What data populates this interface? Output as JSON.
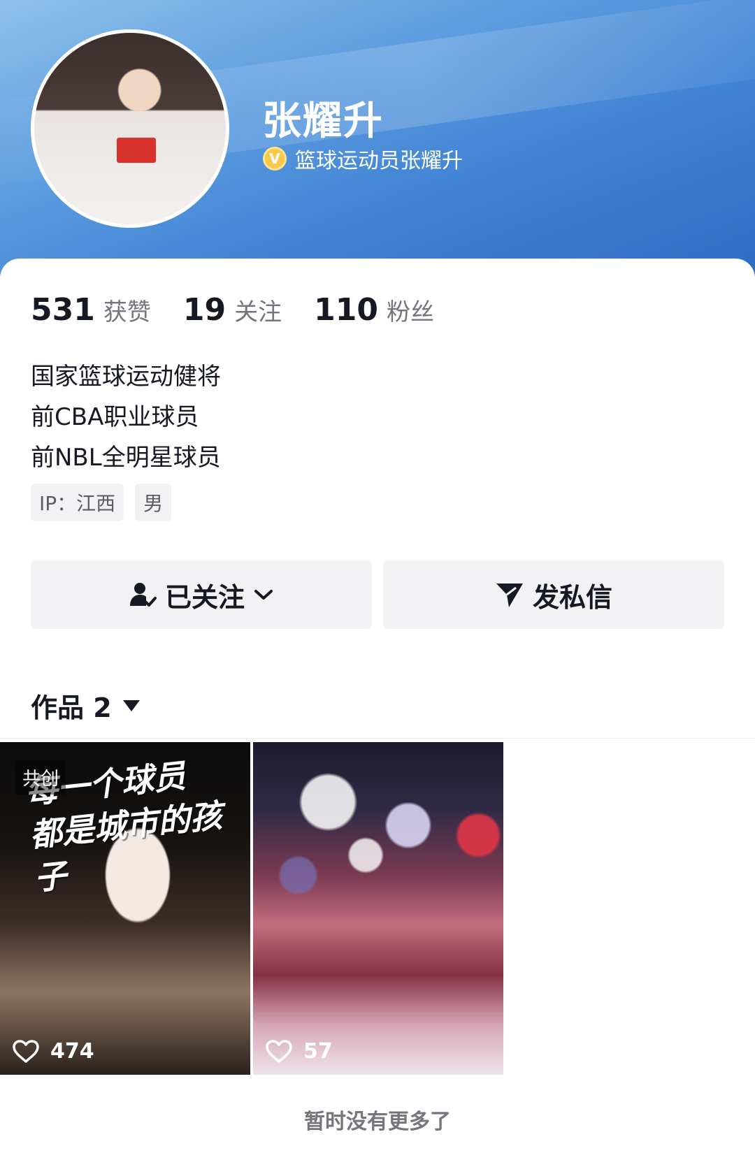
{
  "profile": {
    "name": "张耀升",
    "verified_label": "篮球运动员张耀升",
    "verified_icon": "v-verified-icon",
    "stats": [
      {
        "num": "531",
        "label": "获赞"
      },
      {
        "num": "19",
        "label": "关注"
      },
      {
        "num": "110",
        "label": "粉丝"
      }
    ],
    "bio": [
      "国家篮球运动健将",
      "前CBA职业球员",
      "前NBL全明星球员"
    ],
    "tags": [
      "IP：江西",
      "男"
    ]
  },
  "actions": {
    "follow_label": "已关注",
    "follow_icon": "user-check-icon",
    "message_label": "发私信",
    "message_icon": "send-icon"
  },
  "works": {
    "title": "作品 2",
    "items": [
      {
        "badge": "共创",
        "poster_line1": "每一个球员",
        "poster_line2": "都是城市的孩子",
        "likes": "474"
      },
      {
        "likes": "57"
      }
    ],
    "end_text": "暂时没有更多了"
  },
  "colors": {
    "header_blue": "#3f81d3",
    "button_bg": "#f2f2f4",
    "secondary_text": "#75767c"
  }
}
